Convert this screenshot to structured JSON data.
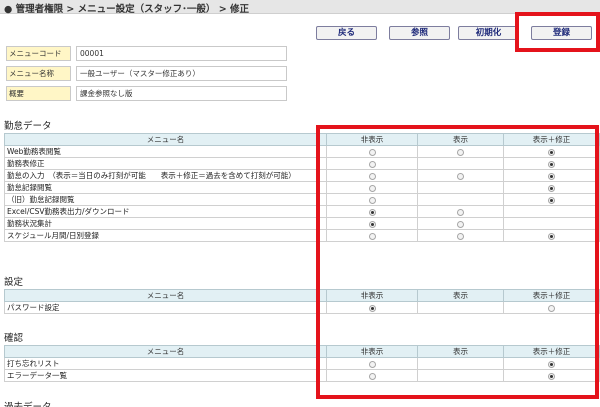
{
  "header": {
    "title": "● 管理者権限 > メニュー設定（スタッフ･一般） > 修正"
  },
  "toolbar": {
    "back": "戻る",
    "browse": "参照",
    "reset": "初期化",
    "register": "登録"
  },
  "info": [
    {
      "label": "メニューコード",
      "value": "00001"
    },
    {
      "label": "メニュー名称",
      "value": "一般ユーザー（マスター修正あり）"
    },
    {
      "label": "概要",
      "value": "課金参照なし版"
    }
  ],
  "columns": {
    "name": "メニュー名",
    "hidden": "非表示",
    "show": "表示",
    "show_edit": "表示＋修正"
  },
  "sections": [
    {
      "title": "勤怠データ",
      "rows": [
        {
          "name": "Web勤務表閲覧",
          "options": [
            0,
            0,
            1
          ],
          "selected": 2
        },
        {
          "name": "勤務表修正",
          "options": [
            0,
            null,
            1
          ],
          "selected": 2
        },
        {
          "name": "勤怠の入力　（表示＝当日のみ打刻が可能　　表示＋修正＝過去を含めて打刻が可能）",
          "options": [
            0,
            0,
            1
          ],
          "selected": 2
        },
        {
          "name": "勤怠記録閲覧",
          "options": [
            0,
            null,
            1
          ],
          "selected": 2
        },
        {
          "name": "（旧）勤怠記録閲覧",
          "options": [
            0,
            null,
            1
          ],
          "selected": 2
        },
        {
          "name": "Excel/CSV勤務表出力/ダウンロード",
          "options": [
            1,
            0,
            null
          ],
          "selected": 0
        },
        {
          "name": "勤務状況集計",
          "options": [
            1,
            0,
            null
          ],
          "selected": 0
        },
        {
          "name": "スケジュール月間/日別登録",
          "options": [
            0,
            0,
            1
          ],
          "selected": 2
        }
      ]
    },
    {
      "title": "設定",
      "rows": [
        {
          "name": "パスワード設定",
          "options": [
            1,
            null,
            0
          ],
          "selected": 0
        }
      ]
    },
    {
      "title": "確認",
      "rows": [
        {
          "name": "打ち忘れリスト",
          "options": [
            0,
            null,
            1
          ],
          "selected": 2
        },
        {
          "name": "エラーデータ一覧",
          "options": [
            0,
            null,
            1
          ],
          "selected": 2
        }
      ]
    }
  ],
  "next_section_partial": "過去データ"
}
